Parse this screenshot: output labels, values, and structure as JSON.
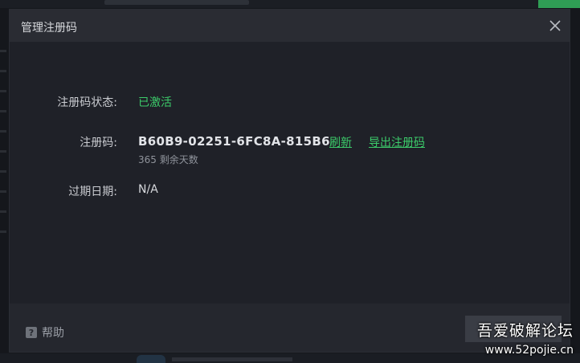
{
  "dialog": {
    "title": "管理注册码"
  },
  "fields": {
    "status_label": "注册码状态:",
    "status_value": "已激活",
    "code_label": "注册码:",
    "code_value": "B60B9-02251-6FC8A-815B6",
    "refresh_link": "刷新",
    "export_link": "导出注册码",
    "days_left": "365 剩余天数",
    "expiry_label": "过期日期:",
    "expiry_value": "N/A"
  },
  "footer": {
    "help_label": "帮助",
    "help_icon_glyph": "?"
  },
  "watermark": {
    "line1": "吾爱破解论坛",
    "line2": "www.52pojie.cn"
  },
  "colors": {
    "accent_green": "#3ccb6a",
    "dialog_bg": "#1f2128",
    "titlebar_bg": "#2a2c33",
    "footer_bg": "#25272e"
  }
}
